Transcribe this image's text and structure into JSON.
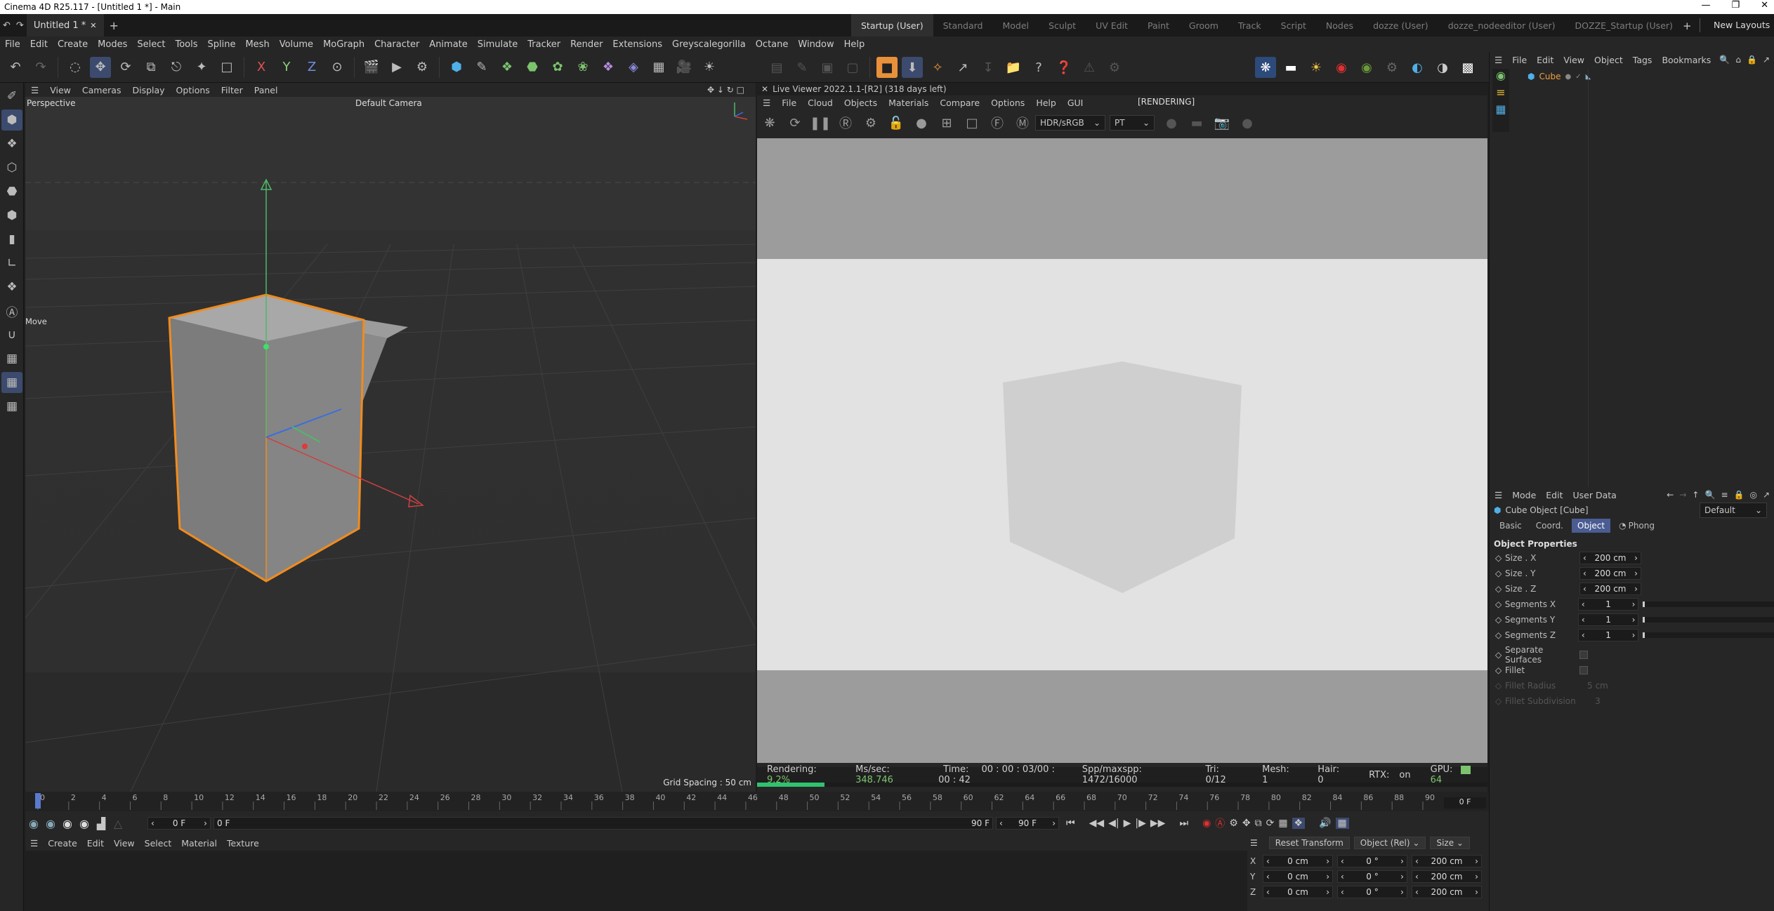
{
  "titlebar": {
    "title": "Cinema 4D R25.117 - [Untitled 1 *] - Main"
  },
  "tabs": {
    "document": "Untitled 1 *",
    "add": "+"
  },
  "layouts": [
    {
      "label": "Startup (User)",
      "active": true
    },
    {
      "label": "Standard"
    },
    {
      "label": "Model"
    },
    {
      "label": "Sculpt"
    },
    {
      "label": "UV Edit"
    },
    {
      "label": "Paint"
    },
    {
      "label": "Groom"
    },
    {
      "label": "Track"
    },
    {
      "label": "Script"
    },
    {
      "label": "Nodes"
    },
    {
      "label": "dozze (User)"
    },
    {
      "label": "dozze_nodeeditor (User)"
    },
    {
      "label": "DOZZE_Startup (User)"
    }
  ],
  "new_layouts": "New Layouts",
  "menu": [
    "File",
    "Edit",
    "Create",
    "Modes",
    "Select",
    "Tools",
    "Spline",
    "Mesh",
    "Volume",
    "MoGraph",
    "Character",
    "Animate",
    "Simulate",
    "Tracker",
    "Render",
    "Extensions",
    "Greyscalegorilla",
    "Octane",
    "Window",
    "Help"
  ],
  "toolbar_axes": [
    "X",
    "Y",
    "Z"
  ],
  "viewport": {
    "menu": [
      "View",
      "Cameras",
      "Display",
      "Options",
      "Filter",
      "Panel"
    ],
    "label": "Perspective",
    "camera": "Default Camera",
    "tool_label": "Move",
    "grid_spacing": "Grid Spacing : 50 cm"
  },
  "liveviewer": {
    "title": "Live Viewer 2022.1.1-[R2] (318 days left)",
    "menu": [
      "File",
      "Cloud",
      "Objects",
      "Materials",
      "Compare",
      "Options",
      "Help",
      "GUI"
    ],
    "status_label": "[RENDERING]",
    "color_mode": "HDR/sRGB",
    "kernel": "PT",
    "status": {
      "rendering_label": "Rendering:",
      "rendering": "9.2%",
      "ms_label": "Ms/sec:",
      "ms": "348.746",
      "time_label": "Time:",
      "time": "00 : 00 : 03/00 : 00 : 42",
      "spp_label": "Spp/maxspp:",
      "spp": "1472/16000",
      "tri_label": "Tri:",
      "tri": "0/12",
      "mesh_label": "Mesh:",
      "mesh": "1",
      "hair_label": "Hair:",
      "hair": "0",
      "rtx_label": "RTX:",
      "rtx": "on",
      "gpu_label": "GPU:",
      "gpu": "64"
    },
    "progress": 0.092
  },
  "objects": {
    "menu": [
      "File",
      "Edit",
      "View",
      "Object",
      "Tags",
      "Bookmarks"
    ],
    "items": [
      {
        "name": "Cube"
      }
    ]
  },
  "attributes": {
    "menu": [
      "Mode",
      "Edit",
      "User Data"
    ],
    "title": "Cube Object [Cube]",
    "preset": "Default",
    "tabs": [
      {
        "label": "Basic"
      },
      {
        "label": "Coord."
      },
      {
        "label": "Object",
        "active": true
      },
      {
        "label": "Phong"
      }
    ],
    "section": "Object Properties",
    "rows": [
      {
        "label": "Size . X",
        "value": "200 cm"
      },
      {
        "label": "Size . Y",
        "value": "200 cm"
      },
      {
        "label": "Size . Z",
        "value": "200 cm"
      },
      {
        "label": "Segments X",
        "value": "1"
      },
      {
        "label": "Segments Y",
        "value": "1"
      },
      {
        "label": "Segments Z",
        "value": "1"
      }
    ],
    "separate_surfaces": "Separate Surfaces",
    "fillet": "Fillet",
    "fillet_radius": {
      "label": "Fillet Radius",
      "value": "5 cm"
    },
    "fillet_subdivision": {
      "label": "Fillet Subdivision",
      "value": "3"
    }
  },
  "timeline": {
    "ticks": [
      "0",
      "2",
      "4",
      "6",
      "8",
      "10",
      "12",
      "14",
      "16",
      "18",
      "20",
      "22",
      "24",
      "26",
      "28",
      "30",
      "32",
      "34",
      "36",
      "38",
      "40",
      "42",
      "44",
      "46",
      "48",
      "50",
      "52",
      "54",
      "56",
      "58",
      "60",
      "62",
      "64",
      "66",
      "68",
      "70",
      "72",
      "74",
      "76",
      "78",
      "80",
      "82",
      "84",
      "86",
      "88",
      "90"
    ],
    "current_frame": "0 F",
    "start": "0 F",
    "range_start": "0 F",
    "range_end": "90 F",
    "end": "90 F"
  },
  "material": {
    "menu": [
      "Create",
      "Edit",
      "View",
      "Select",
      "Material",
      "Texture"
    ]
  },
  "coordinates": {
    "reset": "Reset Transform",
    "mode": "Object (Rel)",
    "size_mode": "Size",
    "rows": [
      {
        "axis": "X",
        "pos": "0 cm",
        "rot": "0 °",
        "size": "200 cm"
      },
      {
        "axis": "Y",
        "pos": "0 cm",
        "rot": "0 °",
        "size": "200 cm"
      },
      {
        "axis": "Z",
        "pos": "0 cm",
        "rot": "0 °",
        "size": "200 cm"
      }
    ]
  }
}
